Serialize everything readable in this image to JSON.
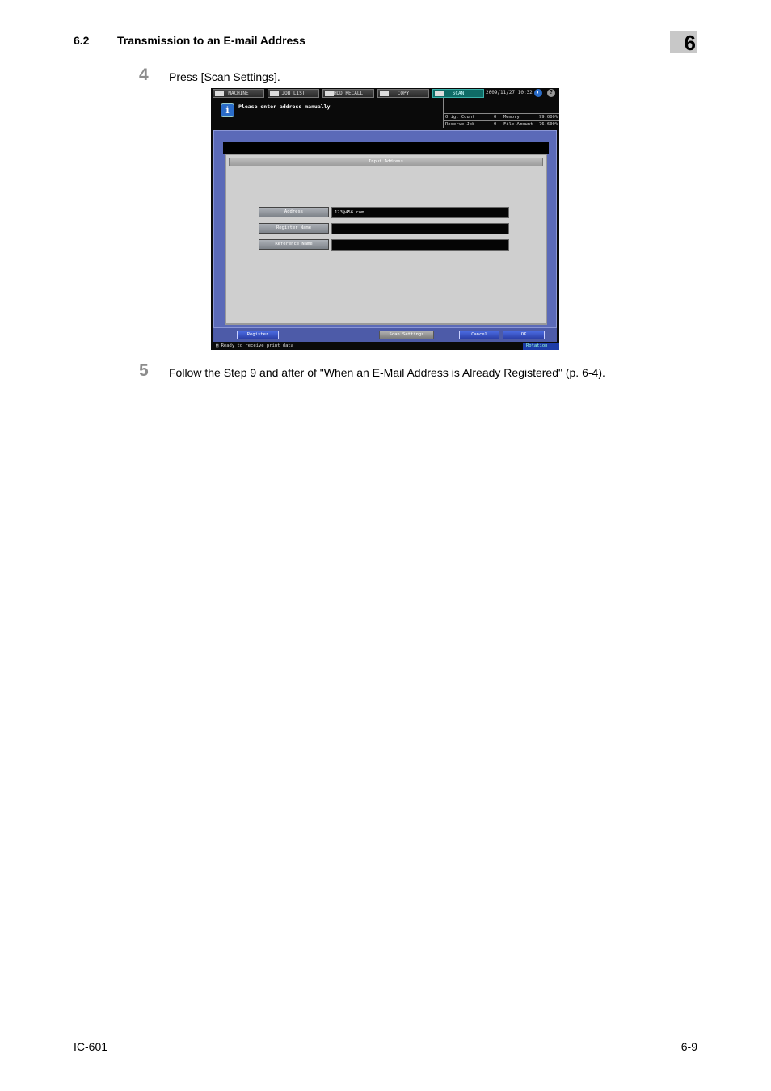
{
  "header": {
    "section_number": "6.2",
    "section_title": "Transmission to an E-mail Address",
    "chapter_number": "6"
  },
  "steps": [
    {
      "number": "4",
      "text": "Press [Scan Settings]."
    },
    {
      "number": "5",
      "text": "Follow the Step 9 and after of \"When an E-Mail Address is Already Registered\" (p. 6-4)."
    }
  ],
  "screen": {
    "tabs": [
      {
        "label": "MACHINE",
        "icon": "machine-icon",
        "active": false
      },
      {
        "label": "JOB LIST",
        "icon": "list-icon",
        "active": false
      },
      {
        "label": "HDD RECALL",
        "icon": "hdd-icon",
        "active": false
      },
      {
        "label": "COPY",
        "icon": "copy-icon",
        "active": false
      },
      {
        "label": "SCAN",
        "icon": "scan-icon",
        "active": true
      }
    ],
    "datetime": "2009/11/27 10:32",
    "message": "Please enter address manually",
    "status": {
      "orig_count_label": "Orig. Count",
      "orig_count_value": "0",
      "memory_label": "Memory",
      "memory_value": "99.000%",
      "reserve_job_label": "Reserve Job",
      "reserve_job_value": "0",
      "file_amount_label": "File Amount",
      "file_amount_value": "76.600%"
    },
    "dialog_title": "Input Address",
    "fields": [
      {
        "label": "Address",
        "value": "123@456.com"
      },
      {
        "label": "Register Name",
        "value": ""
      },
      {
        "label": "Reference Name",
        "value": ""
      }
    ],
    "buttons": {
      "register": "Register",
      "scan_settings": "Scan Settings",
      "cancel": "Cancel",
      "ok": "OK"
    },
    "status_line": "Ready to receive print data",
    "rotation": "Rotation"
  },
  "footer": {
    "left": "IC-601",
    "right": "6-9"
  },
  "colors": {
    "panel_blue": "#5b6ab8",
    "active_tab": "#0f6b66",
    "step_number_grey": "#8c8c8c"
  }
}
